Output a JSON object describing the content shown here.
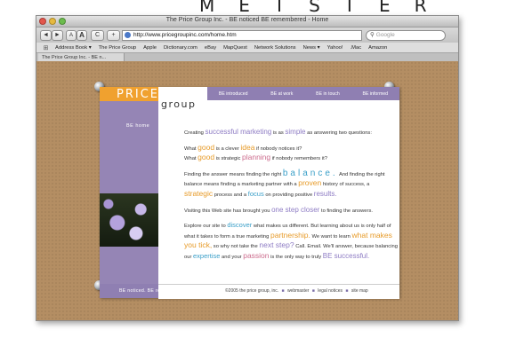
{
  "corner_word": "METSTER",
  "window": {
    "title": "The Price Group Inc. - BE noticed BE remembered - Home",
    "toolbar": {
      "back": "◄",
      "forward": "►",
      "text_small": "A",
      "text_large": "A",
      "reload": "C",
      "add": "+",
      "url": "http://www.pricegroupinc.com/home.htm",
      "search_placeholder": "Google"
    },
    "bookmarks": [
      "Address Book ▾",
      "The Price Group",
      "Apple",
      "Dictionary.com",
      "eBay",
      "MapQuest",
      "Network Solutions",
      "News ▾",
      "Yahoo!",
      ".Mac",
      "Amazon"
    ],
    "tab_label": "The Price Group Inc. - BE n..."
  },
  "site": {
    "logo_price": "PRICE",
    "logo_group": "group",
    "nav": [
      "BE introduced",
      "BE at work",
      "BE in touch",
      "BE informed"
    ],
    "sidebar_label": "BE home",
    "footer_tag": "BE noticed. BE remembered.",
    "footer_links": [
      "©2005 the price group, inc.",
      "webmaster",
      "legal notices",
      "site map"
    ],
    "footer_sep": "■",
    "content": {
      "p1": {
        "a": "Creating ",
        "k1": "successful marketing",
        "b": " is as ",
        "k2": "simple",
        "c": " as answering two questions:"
      },
      "p2": {
        "a": "What ",
        "k1": "good",
        "b": " is a clever ",
        "k2": "idea",
        "c": " if nobody notices it?",
        "d": "What ",
        "k3": "good",
        "e": " is strategic ",
        "k4": "planning",
        "f": " if nobody remembers it?"
      },
      "p3": {
        "a": "Finding the answer means finding the right ",
        "k1": "balance.",
        "b": " And finding the right balance means finding a marketing partner with a ",
        "k2": "proven",
        "c": " history of success, a ",
        "k3": "strategic",
        "d": " process and a ",
        "k4": "focus",
        "e": " on providing positive ",
        "k5": "results."
      },
      "p4": {
        "a": "Visiting this Web site has brought you ",
        "k1": "one step closer",
        "b": " to finding the answers."
      },
      "p5": {
        "a": "Explore our site to ",
        "k1": "discover",
        "b": " what makes us different. But learning about us is only half of what it takes to form a true marketing ",
        "k2": "partnership.",
        "c": " We want to learn ",
        "k3": "what makes you tick,",
        "d": " so why not take the ",
        "k4": "next step?",
        "e": " Call. Email. We'll answer, because balancing our ",
        "k5": "expertise",
        "f": " and your ",
        "k6": "passion",
        "g": " is the only way to truly ",
        "k7": "BE successful."
      }
    }
  }
}
